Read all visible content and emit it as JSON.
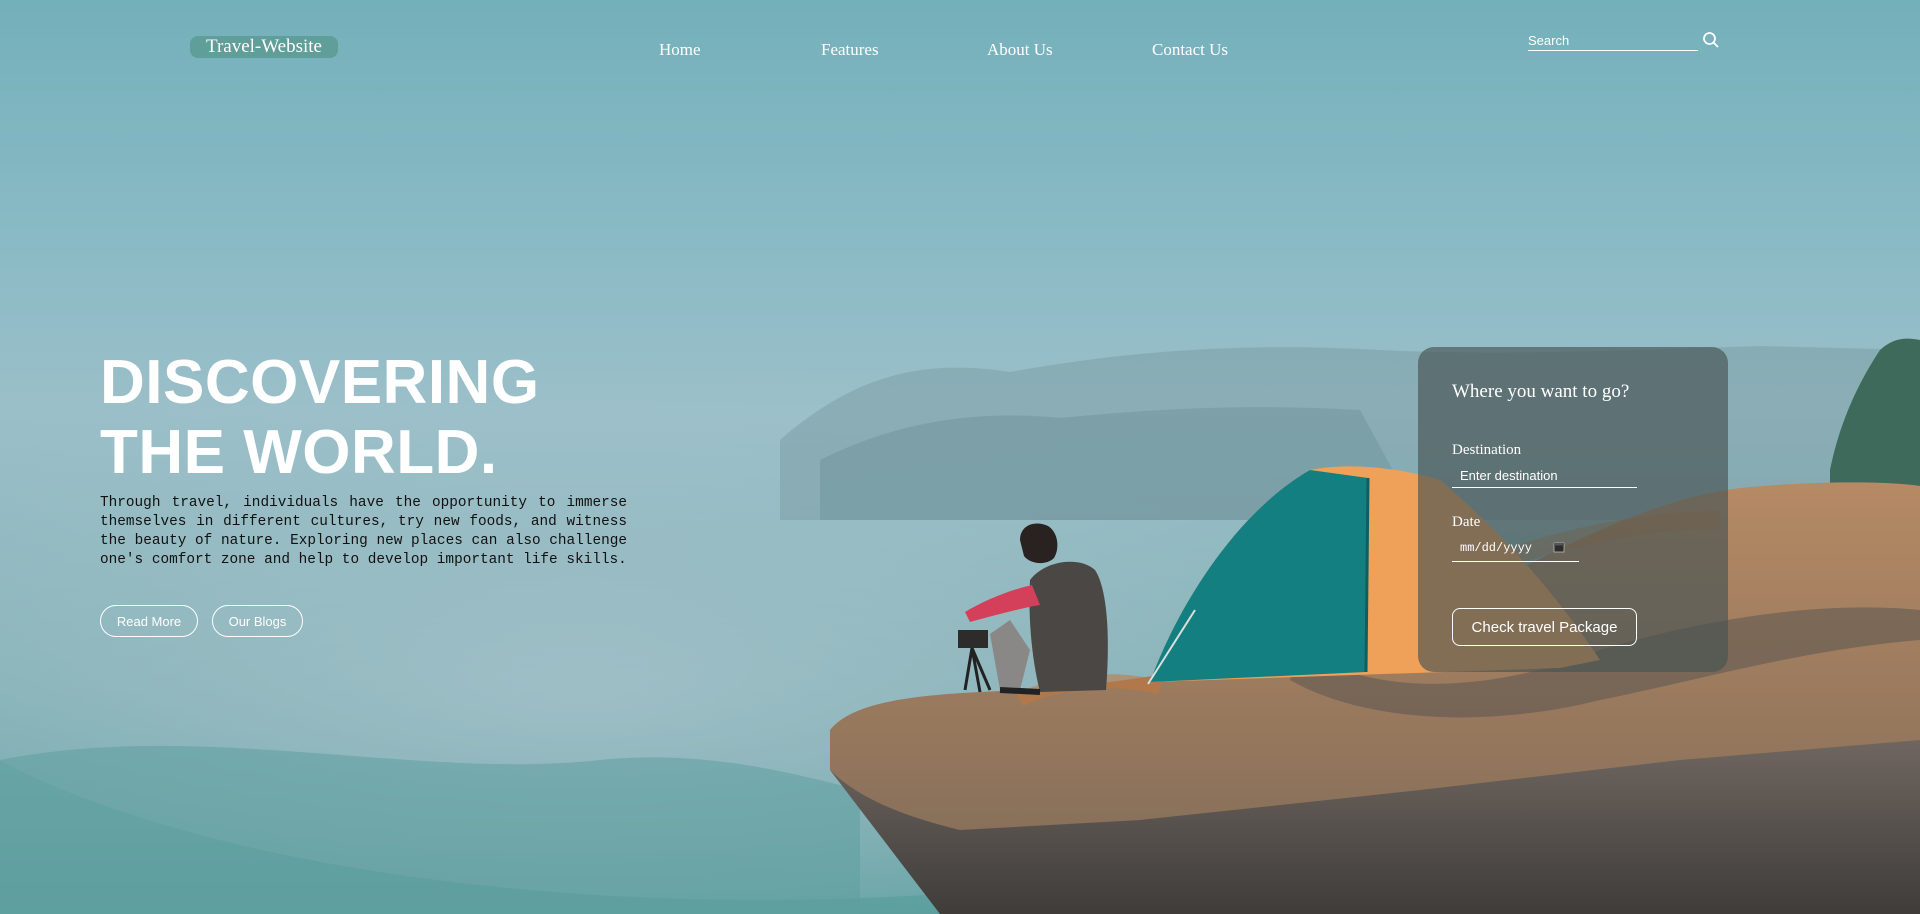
{
  "header": {
    "logo": "Travel-Website",
    "nav": [
      "Home",
      "Features",
      "About Us",
      "Contact Us"
    ],
    "search_placeholder": "Search"
  },
  "hero": {
    "title_line1": "DISCOVERING",
    "title_line2": "THE WORLD.",
    "description": "Through travel, individuals have the opportunity to immerse themselves in different cultures, try new foods, and witness the beauty of nature. Exploring new places can also challenge one's comfort zone and help to develop important life skills.",
    "read_more": "Read More",
    "our_blogs": "Our Blogs"
  },
  "booking": {
    "title": "Where you want to go?",
    "destination_label": "Destination",
    "destination_placeholder": "Enter destination",
    "date_label": "Date",
    "date_placeholder": "mm/dd/yyyy",
    "submit": "Check travel Package"
  },
  "icons": {
    "search": "search-icon",
    "calendar": "calendar-icon"
  },
  "colors": {
    "sky": "#7fb2bd",
    "logo_bg": "#5f9e99",
    "card_bg": "rgba(72,84,84,0.66)",
    "text_light": "#ffffff",
    "text_dark": "#111111"
  }
}
